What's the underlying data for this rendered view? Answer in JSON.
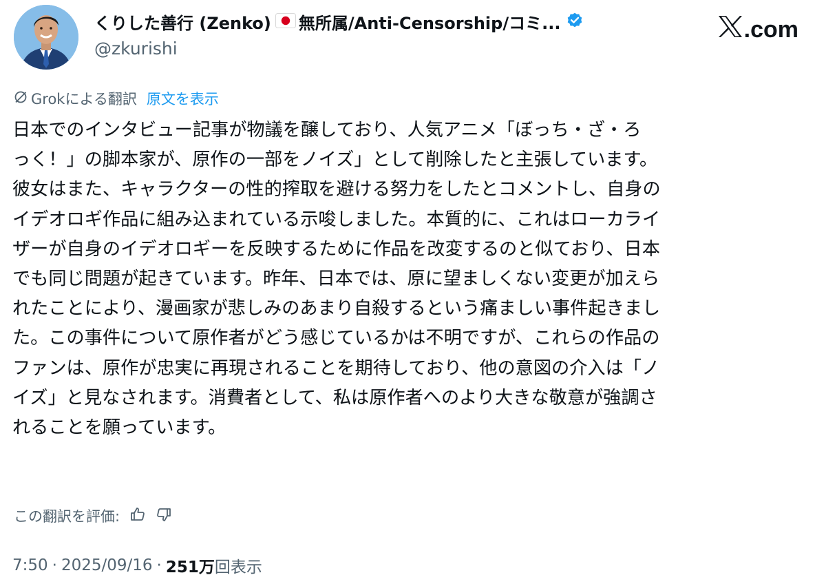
{
  "author": {
    "display_name": "くりした善行 (Zenko)",
    "flag_icon": "japan-flag-icon",
    "display_name_suffix": "無所属/Anti-Censorship/コミ...",
    "verified_icon": "verified-badge-icon",
    "verified_color": "#1d9bf0",
    "handle": "@zkurishi",
    "avatar_icon": "profile-photo"
  },
  "brand": {
    "logo_icon": "x-logo-icon",
    "domain": ".com"
  },
  "translation": {
    "grok_icon": "grok-icon",
    "label": "Grokによる翻訳",
    "show_original": "原文を表示",
    "link_color": "#1d9bf0"
  },
  "tweet": {
    "lines": [
      " 日本でのインタビュー記事が物議を醸しており、人気アニメ「ぼっち・ざ・ろ",
      "っく！」の脚本家が、原作の一部をノイズ」として削除したと主張しています。",
      "彼女はまた、キャラクターの性的搾取を避ける努力をしたとコメントし、自身の",
      "イデオロギ作品に組み込まれている示唆しました。本質的に、これはローカライ",
      "ザーが自身のイデオロギーを反映するために作品を改変するのと似ており、日本",
      "でも同じ問題が起きています。昨年、日本では、原に望ましくない変更が加えら",
      "れたことにより、漫画家が悲しみのあまり自殺するという痛ましい事件起きまし",
      "た。この事件について原作者がどう感じているかは不明ですが、これらの作品の",
      "ファンは、原作が忠実に再現されることを期待しており、他の意図の介入は「ノ",
      "イズ」と見なされます。消費者として、私は原作者へのより大きな敬意が強調さ",
      "れることを願っています。"
    ]
  },
  "rating": {
    "label": "この翻訳を評価:",
    "thumbs_up_icon": "thumbs-up-icon",
    "thumbs_down_icon": "thumbs-down-icon"
  },
  "meta": {
    "time": "7:50",
    "separator": "·",
    "date": "2025/09/16",
    "views_count": "251万",
    "views_label": "回表示"
  }
}
